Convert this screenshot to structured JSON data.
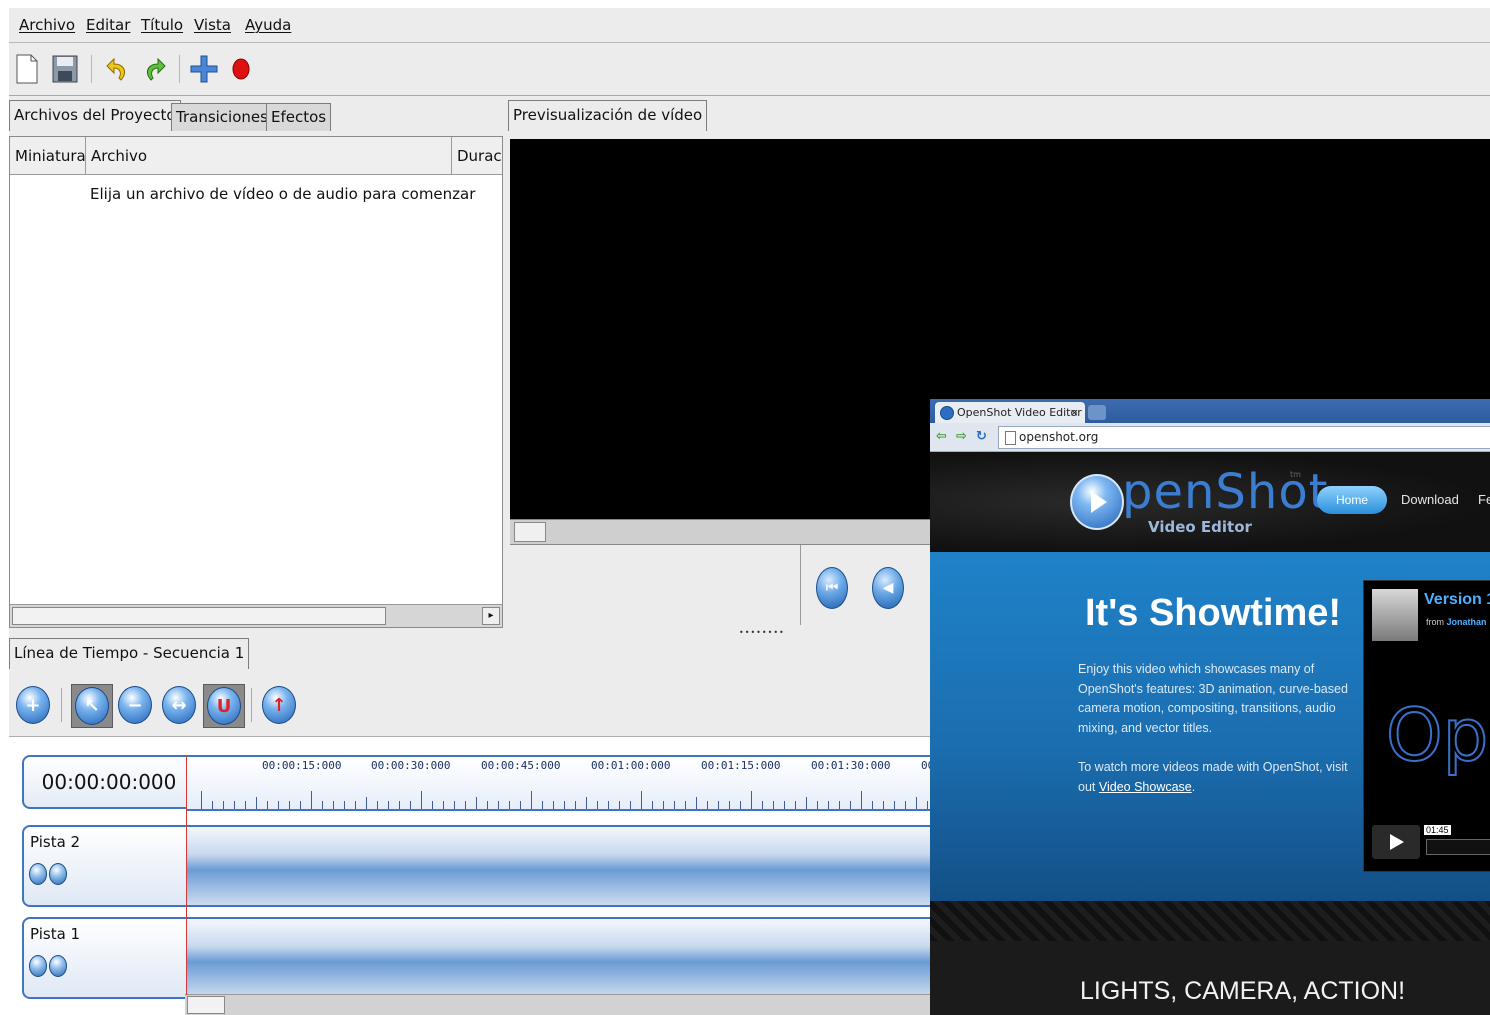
{
  "menu": [
    "Archivo",
    "Editar",
    "Título",
    "Vista",
    "Ayuda"
  ],
  "left_tabs": [
    "Archivos del Proyecto",
    "Transiciones",
    "Efectos"
  ],
  "preview_tab": "Previsualización de vídeo",
  "file_columns": [
    "Miniatura",
    "Archivo",
    "Durac"
  ],
  "empty_message": "Elija un archivo de vídeo o de audio para comenzar",
  "timeline_tab": "Línea de Tiempo - Secuencia 1",
  "timecode": "00:00:00:000",
  "ruler_labels": [
    "00:00:15:000",
    "00:00:30:000",
    "00:00:45:000",
    "00:01:00:000",
    "00:01:15:000",
    "00:01:30:000",
    "00"
  ],
  "tracks": [
    "Pista 2",
    "Pista 1"
  ],
  "browser": {
    "tab_title": "OpenShot Video Editor",
    "tab_close": "×",
    "url": "openshot.org",
    "logo_text": "penShot",
    "logo_sub": "Video Editor",
    "logo_tm": "tm",
    "nav": [
      "Home",
      "Download",
      "Fe"
    ],
    "hero_title": "It's Showtime!",
    "hero_p1": "Enjoy this video which showcases many of OpenShot's features: 3D animation, curve-based camera motion, compositing, transitions, audio mixing, and vector titles.",
    "hero_p2_prefix": "To watch more videos made with OpenShot, visit out ",
    "hero_link": "Video Showcase",
    "hero_p2_suffix": ".",
    "video_title": "Version 1",
    "video_from_prefix": "from ",
    "video_from_name": "Jonathan",
    "video_logo": "Op",
    "video_time": "01:45",
    "bottom_text": "LIGHTS, CAMERA, ACTION!"
  },
  "colors": {
    "timeline_blue": "#3f73c4",
    "playhead": "#d43a3a",
    "record": "#dd1111",
    "brand_blue": "#1f82c8"
  }
}
